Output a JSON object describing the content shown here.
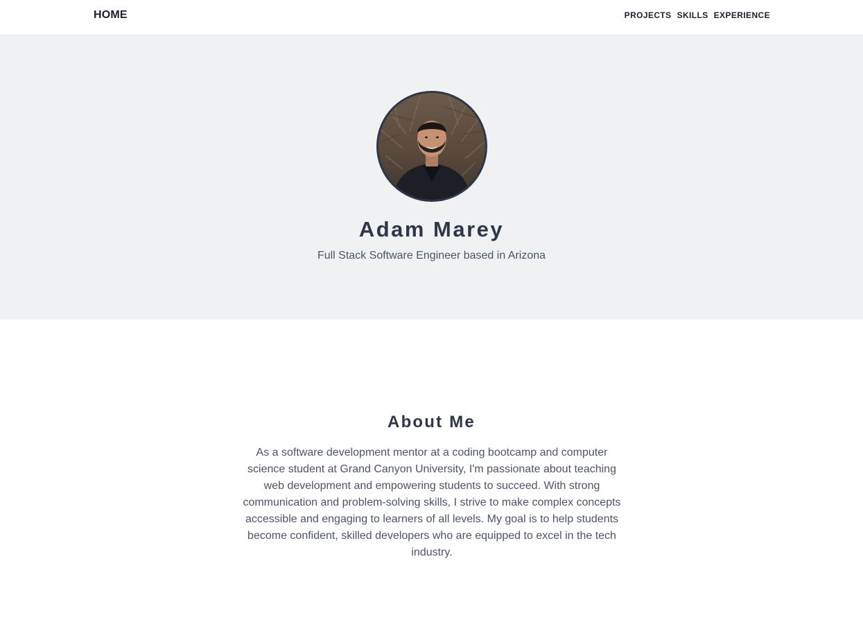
{
  "nav": {
    "home_label": "HOME",
    "links": [
      {
        "label": "PROJECTS"
      },
      {
        "label": "SKILLS"
      },
      {
        "label": "EXPERIENCE"
      }
    ]
  },
  "hero": {
    "avatar_icon": "profile-photo",
    "name": "Adam Marey",
    "subtitle": "Full Stack Software Engineer based in Arizona"
  },
  "about": {
    "title": "About Me",
    "text": "As a software development mentor at a coding bootcamp and computer science student at Grand Canyon University, I'm passionate about teaching web development and empowering students to succeed. With strong communication and problem-solving skills, I strive to make complex concepts accessible and engaging to learners of all levels. My goal is to help students become confident, skilled developers who are equipped to excel in the tech industry."
  },
  "colors": {
    "hero_background": "#f0f1f3",
    "heading": "#2d3748",
    "body_text": "#4a5568",
    "avatar_border": "#2d3748"
  }
}
